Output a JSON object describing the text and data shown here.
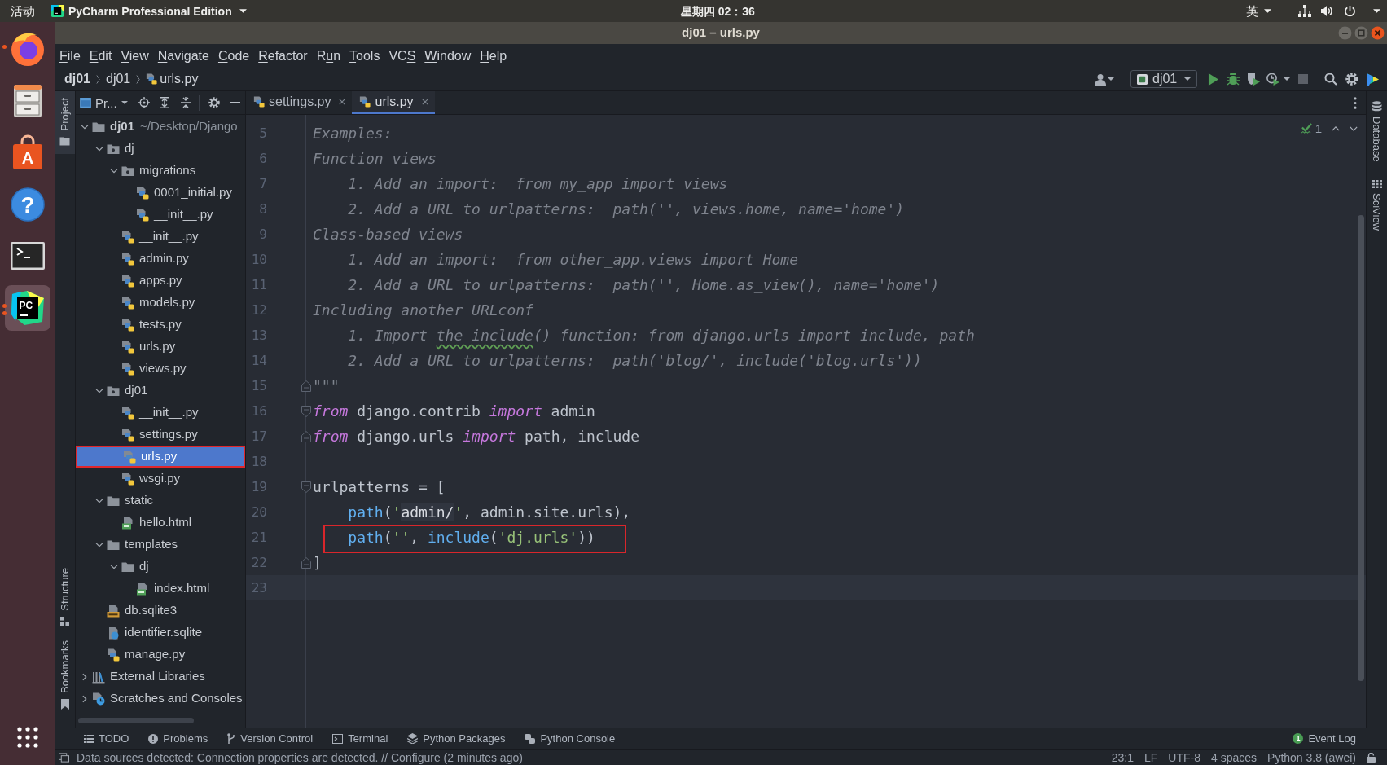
{
  "top_bar": {
    "activities": "活动",
    "app_menu": "PyCharm Professional Edition",
    "clock": "星期四 02：36",
    "input_method": "英"
  },
  "dock": [
    {
      "kind": "browser",
      "running": true,
      "several_windows": false,
      "selected": false
    },
    {
      "kind": "files",
      "running": false,
      "selected": false
    },
    {
      "kind": "software",
      "glyph": "A",
      "running": false,
      "selected": false
    },
    {
      "kind": "help",
      "glyph": "?",
      "running": false,
      "selected": false
    },
    {
      "kind": "terminal",
      "running": false,
      "selected": false
    },
    {
      "kind": "pycharm",
      "glyph": "PC",
      "running": true,
      "several_windows": true,
      "selected": true
    }
  ],
  "window": {
    "title": "dj01 – urls.py"
  },
  "menu": [
    {
      "key": "F",
      "post": "ile"
    },
    {
      "key": "E",
      "post": "dit"
    },
    {
      "key": "V",
      "post": "iew"
    },
    {
      "key": "N",
      "post": "avigate"
    },
    {
      "key": "C",
      "post": "ode"
    },
    {
      "key": "R",
      "post": "efactor"
    },
    {
      "pre": "R",
      "key": "u",
      "post": "n"
    },
    {
      "key": "T",
      "post": "ools"
    },
    {
      "pre": "VC",
      "key": "S"
    },
    {
      "key": "W",
      "post": "indow"
    },
    {
      "key": "H",
      "post": "elp"
    }
  ],
  "navigation_bar": {
    "breadcrumbs": [
      {
        "label": "dj01",
        "kind": "project"
      },
      {
        "label": "dj01",
        "kind": "folder"
      },
      {
        "label": "urls.py",
        "kind": "python"
      }
    ],
    "run_configuration": "dj01"
  },
  "left_tool_strip": {
    "top": [
      {
        "label": "Project",
        "kind": "project",
        "selected": true
      }
    ],
    "bottom": [
      {
        "label": "Structure",
        "kind": "structure",
        "selected": false
      },
      {
        "label": "Bookmarks",
        "kind": "bookmarks",
        "selected": false
      }
    ]
  },
  "project_panel": {
    "view": "Pr...",
    "tree": [
      {
        "label": "dj01",
        "hint": "~/Desktop/Django",
        "kind": "root",
        "expanded": true,
        "selected": false,
        "boxed": false,
        "children": [
          {
            "label": "dj",
            "kind": "package",
            "expanded": true,
            "selected": false,
            "boxed": false,
            "children": [
              {
                "label": "migrations",
                "kind": "package",
                "expanded": true,
                "selected": false,
                "boxed": false,
                "children": [
                  {
                    "label": "0001_initial.py",
                    "kind": "python",
                    "selected": false,
                    "boxed": false
                  },
                  {
                    "label": "__init__.py",
                    "kind": "python",
                    "selected": false,
                    "boxed": false
                  }
                ]
              },
              {
                "label": "__init__.py",
                "kind": "python",
                "selected": false,
                "boxed": false
              },
              {
                "label": "admin.py",
                "kind": "python",
                "selected": false,
                "boxed": false
              },
              {
                "label": "apps.py",
                "kind": "python",
                "selected": false,
                "boxed": false
              },
              {
                "label": "models.py",
                "kind": "python",
                "selected": false,
                "boxed": false
              },
              {
                "label": "tests.py",
                "kind": "python",
                "selected": false,
                "boxed": false
              },
              {
                "label": "urls.py",
                "kind": "python",
                "selected": false,
                "boxed": false
              },
              {
                "label": "views.py",
                "kind": "python",
                "selected": false,
                "boxed": false
              }
            ]
          },
          {
            "label": "dj01",
            "kind": "package",
            "expanded": true,
            "selected": false,
            "boxed": false,
            "children": [
              {
                "label": "__init__.py",
                "kind": "python",
                "selected": false,
                "boxed": false
              },
              {
                "label": "settings.py",
                "kind": "python",
                "selected": false,
                "boxed": false
              },
              {
                "label": "urls.py",
                "kind": "python",
                "selected": true,
                "boxed": true
              },
              {
                "label": "wsgi.py",
                "kind": "python",
                "selected": false,
                "boxed": false
              }
            ]
          },
          {
            "label": "static",
            "kind": "folder",
            "expanded": true,
            "selected": false,
            "boxed": false,
            "children": [
              {
                "label": "hello.html",
                "kind": "html",
                "selected": false,
                "boxed": false
              }
            ]
          },
          {
            "label": "templates",
            "kind": "folder",
            "expanded": true,
            "selected": false,
            "boxed": false,
            "children": [
              {
                "label": "dj",
                "kind": "folder",
                "expanded": true,
                "selected": false,
                "boxed": false,
                "children": [
                  {
                    "label": "index.html",
                    "kind": "html",
                    "selected": false,
                    "boxed": false
                  }
                ]
              }
            ]
          },
          {
            "label": "db.sqlite3",
            "kind": "sqlite",
            "selected": false,
            "boxed": false
          },
          {
            "label": "identifier.sqlite",
            "kind": "unknown",
            "selected": false,
            "boxed": false
          },
          {
            "label": "manage.py",
            "kind": "python",
            "selected": false,
            "boxed": false
          }
        ]
      },
      {
        "label": "External Libraries",
        "kind": "libraries",
        "expanded": false,
        "selected": false,
        "boxed": false
      },
      {
        "label": "Scratches and Consoles",
        "kind": "scratches",
        "expanded": false,
        "selected": false,
        "boxed": false
      }
    ]
  },
  "editor": {
    "tabs": [
      {
        "label": "settings.py",
        "kind": "python",
        "selected": false
      },
      {
        "label": "urls.py",
        "kind": "python",
        "selected": true
      }
    ],
    "inspection_count": "1",
    "lines": [
      {
        "number": "5",
        "current": false,
        "boxed": false,
        "fold_start": false,
        "fold_end": false,
        "tokens": [
          {
            "text": "Examples:",
            "kind": "docstring"
          }
        ]
      },
      {
        "number": "6",
        "current": false,
        "boxed": false,
        "fold_start": false,
        "fold_end": false,
        "tokens": [
          {
            "text": "Function views",
            "kind": "docstring"
          }
        ]
      },
      {
        "number": "7",
        "current": false,
        "boxed": false,
        "fold_start": false,
        "fold_end": false,
        "tokens": [
          {
            "text": "    1. Add an import:  from my_app import views",
            "kind": "docstring"
          }
        ]
      },
      {
        "number": "8",
        "current": false,
        "boxed": false,
        "fold_start": false,
        "fold_end": false,
        "tokens": [
          {
            "text": "    2. Add a URL to urlpatterns:  path('', views.home, name='home')",
            "kind": "docstring"
          }
        ]
      },
      {
        "number": "9",
        "current": false,
        "boxed": false,
        "fold_start": false,
        "fold_end": false,
        "tokens": [
          {
            "text": "Class-based views",
            "kind": "docstring"
          }
        ]
      },
      {
        "number": "10",
        "current": false,
        "boxed": false,
        "fold_start": false,
        "fold_end": false,
        "tokens": [
          {
            "text": "    1. Add an import:  from other_app.views import Home",
            "kind": "docstring"
          }
        ]
      },
      {
        "number": "11",
        "current": false,
        "boxed": false,
        "fold_start": false,
        "fold_end": false,
        "tokens": [
          {
            "text": "    2. Add a URL to urlpatterns:  path('', Home.as_view(), name='home')",
            "kind": "docstring"
          }
        ]
      },
      {
        "number": "12",
        "current": false,
        "boxed": false,
        "fold_start": false,
        "fold_end": false,
        "tokens": [
          {
            "text": "Including another URLconf",
            "kind": "docstring"
          }
        ]
      },
      {
        "number": "13",
        "current": false,
        "boxed": false,
        "fold_start": false,
        "fold_end": false,
        "tokens": [
          {
            "text": "    1. Import ",
            "kind": "docstring"
          },
          {
            "text": "the include",
            "kind": "spelling"
          },
          {
            "text": "() function: from django.urls import include, path",
            "kind": "docstring"
          }
        ]
      },
      {
        "number": "14",
        "current": false,
        "boxed": false,
        "fold_start": false,
        "fold_end": false,
        "tokens": [
          {
            "text": "    2. Add a URL to urlpatterns:  path('blog/', include('blog.urls'))",
            "kind": "docstring"
          }
        ]
      },
      {
        "number": "15",
        "current": false,
        "boxed": false,
        "fold_start": false,
        "fold_end": true,
        "tokens": [
          {
            "text": "\"\"\"",
            "kind": "docstring"
          }
        ]
      },
      {
        "number": "16",
        "current": false,
        "boxed": false,
        "fold_start": true,
        "fold_end": false,
        "tokens": [
          {
            "text": "from",
            "kind": "keyword"
          },
          {
            "text": " django.contrib ",
            "kind": "plain"
          },
          {
            "text": "import",
            "kind": "keyword"
          },
          {
            "text": " admin",
            "kind": "plain"
          }
        ]
      },
      {
        "number": "17",
        "current": false,
        "boxed": false,
        "fold_start": false,
        "fold_end": true,
        "tokens": [
          {
            "text": "from",
            "kind": "keyword"
          },
          {
            "text": " django.urls ",
            "kind": "plain"
          },
          {
            "text": "import",
            "kind": "keyword"
          },
          {
            "text": " path, include",
            "kind": "plain"
          }
        ]
      },
      {
        "number": "18",
        "current": false,
        "boxed": false,
        "fold_start": false,
        "fold_end": false
      },
      {
        "number": "19",
        "current": false,
        "boxed": false,
        "fold_start": true,
        "fold_end": false,
        "tokens": [
          {
            "text": "urlpatterns = [",
            "kind": "plain"
          }
        ]
      },
      {
        "number": "20",
        "current": false,
        "boxed": false,
        "fold_start": false,
        "fold_end": false,
        "tokens": [
          {
            "text": "    path",
            "kind": "function"
          },
          {
            "text": "(",
            "kind": "plain"
          },
          {
            "text": "'",
            "kind": "string"
          },
          {
            "text": "admin/",
            "kind": "url"
          },
          {
            "text": "'",
            "kind": "string"
          },
          {
            "text": ", admin.site.urls),",
            "kind": "plain"
          }
        ]
      },
      {
        "number": "21",
        "current": false,
        "boxed": true,
        "fold_start": false,
        "fold_end": false,
        "tokens": [
          {
            "text": "    path",
            "kind": "function"
          },
          {
            "text": "(",
            "kind": "plain"
          },
          {
            "text": "''",
            "kind": "string"
          },
          {
            "text": ", ",
            "kind": "plain"
          },
          {
            "text": "include",
            "kind": "function"
          },
          {
            "text": "(",
            "kind": "plain"
          },
          {
            "text": "'dj.urls'",
            "kind": "string"
          },
          {
            "text": "))",
            "kind": "plain"
          }
        ]
      },
      {
        "number": "22",
        "current": false,
        "boxed": false,
        "fold_start": false,
        "fold_end": true,
        "tokens": [
          {
            "text": "]",
            "kind": "plain"
          }
        ]
      },
      {
        "number": "23",
        "current": true,
        "boxed": false,
        "fold_start": false,
        "fold_end": false
      }
    ]
  },
  "right_tool_strip": [
    {
      "label": "Database",
      "kind": "database"
    },
    {
      "label": "SciView",
      "kind": "sciview"
    }
  ],
  "tool_windows": [
    {
      "label": "TODO",
      "kind": "todo"
    },
    {
      "label": "Problems",
      "kind": "problems"
    },
    {
      "label": "Version Control",
      "kind": "vcs"
    },
    {
      "label": "Terminal",
      "kind": "terminal"
    },
    {
      "label": "Python Packages",
      "kind": "packages"
    },
    {
      "label": "Python Console",
      "kind": "console"
    }
  ],
  "event_log": {
    "label": "Event Log",
    "badge": "1"
  },
  "status_bar": {
    "message": "Data sources detected: Connection properties are detected. // Configure (2 minutes ago)",
    "items": [
      "23:1",
      "LF",
      "UTF-8",
      "4 spaces",
      "Python 3.8 (awei)"
    ]
  }
}
